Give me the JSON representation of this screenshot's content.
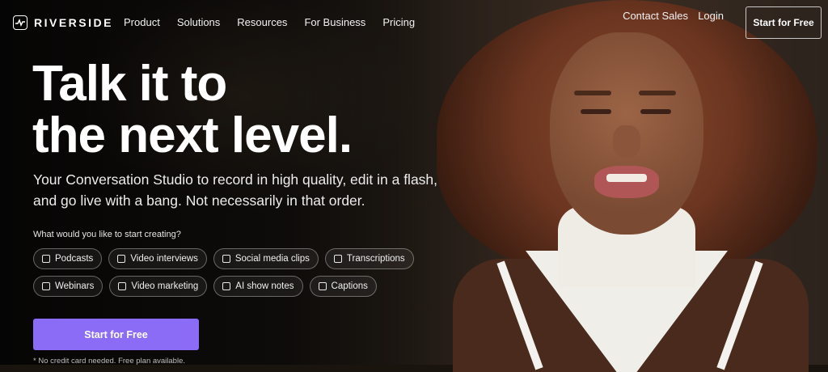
{
  "brand": {
    "name": "RIVERSIDE",
    "icon": "waveform-icon"
  },
  "nav": {
    "links": [
      "Product",
      "Solutions",
      "Resources",
      "For Business",
      "Pricing"
    ],
    "contact": "Contact Sales",
    "login": "Login",
    "cta": "Start for Free"
  },
  "hero": {
    "headline_line1": "Talk it to",
    "headline_line2": "the next level.",
    "subtitle": "Your Conversation Studio to record in high quality, edit in a flash, and go live with a bang. Not necessarily in that order.",
    "question": "What would you like to start creating?",
    "options_row1": [
      "Podcasts",
      "Video interviews",
      "Social media clips",
      "Transcriptions"
    ],
    "options_row2": [
      "Webinars",
      "Video marketing",
      "AI show notes",
      "Captions"
    ],
    "cta": "Start for Free",
    "note": "* No credit card needed. Free plan available."
  },
  "colors": {
    "accent": "#8b6cf6",
    "background": "#1a140f"
  }
}
